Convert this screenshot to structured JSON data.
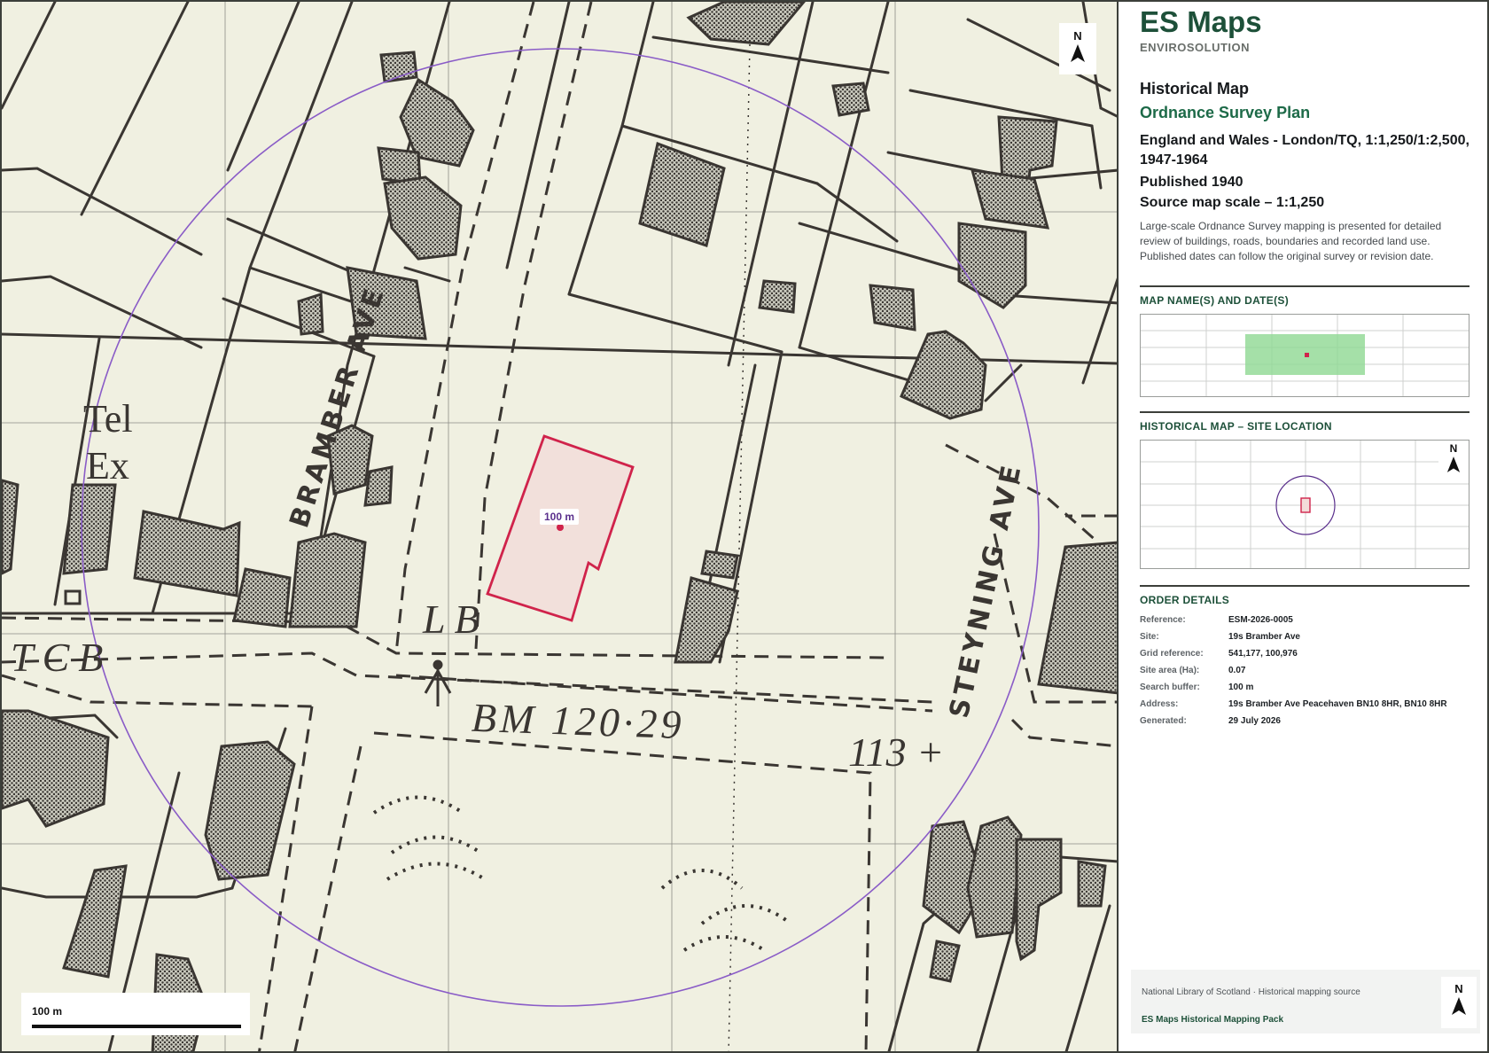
{
  "map": {
    "labels": {
      "tel": "Tel",
      "ex": "Ex",
      "tcb": "TCB",
      "lb": "LB",
      "bm": "BM 120·29",
      "spot_height": "113 +",
      "bramber": "BRAMBER AVE",
      "steyning": "STEYNING AVE"
    },
    "north_label": "N",
    "buffer_label": "100 m",
    "scale_label": "100 m",
    "colors": {
      "buffer": "#8a5cc7",
      "site_outline": "#d0234b",
      "site_fill": "#f3dcd9",
      "paper": "#f0f0e1"
    }
  },
  "brand": {
    "name": "ES Maps",
    "sub": "ENVIROSOLUTION"
  },
  "heading": {
    "title": "Historical Map",
    "map_type": "Ordnance Survey Plan",
    "series": "England and Wales - London/TQ, 1:1,250/1:2,500, 1947-1964",
    "published": "Published 1940",
    "source_scale": "Source map scale – 1:1,250",
    "description": "Large-scale Ordnance Survey mapping is presented for detailed review of buildings, roads, boundaries and recorded land use. Published dates can follow the original survey or revision date."
  },
  "sections": {
    "map_names": "MAP NAME(S) AND DATE(S)",
    "site_location": "HISTORICAL MAP – SITE LOCATION",
    "order_details": "ORDER DETAILS"
  },
  "location_north": "N",
  "order": [
    {
      "key": "Reference:",
      "value": "ESM-2026-0005"
    },
    {
      "key": "Site:",
      "value": "19s Bramber Ave"
    },
    {
      "key": "Grid reference:",
      "value": "541,177, 100,976"
    },
    {
      "key": "Site area (Ha):",
      "value": "0.07"
    },
    {
      "key": "Search buffer:",
      "value": "100 m"
    },
    {
      "key": "Address:",
      "value": "19s Bramber Ave Peacehaven BN10 8HR, BN10 8HR"
    },
    {
      "key": "Generated:",
      "value": "29 July 2026"
    }
  ],
  "footer": {
    "source": "National Library of Scotland · Historical mapping source",
    "pack": "ES Maps Historical Mapping Pack",
    "north": "N"
  }
}
